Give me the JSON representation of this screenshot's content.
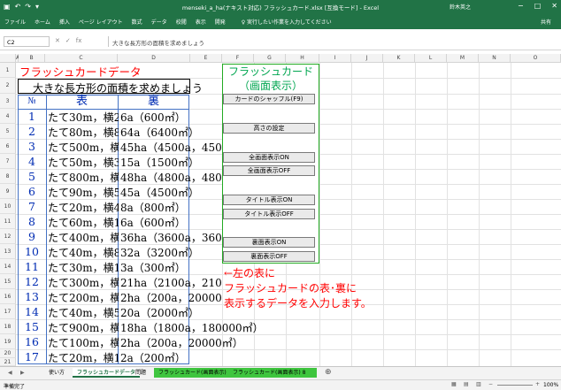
{
  "window": {
    "title": "menseki_a_ha(ナキスト対応) フラッシュカード.xlsx [互換モード] - Excel",
    "user": "鈴木英之",
    "controls": [
      "−",
      "□",
      "✕"
    ]
  },
  "ribbon_tabs": [
    "ファイル",
    "ホーム",
    "挿入",
    "ページ レイアウト",
    "数式",
    "データ",
    "校閲",
    "表示",
    "開発"
  ],
  "tell_me": "♀ 実行したい作業を入力してください",
  "share": "共有",
  "formula_bar": {
    "name_box": "C2",
    "formula": "大きな長方形の面積を求めましょう"
  },
  "columns": [
    "A",
    "B",
    "C",
    "D",
    "E",
    "F",
    "G",
    "H",
    "I",
    "J",
    "K",
    "L",
    "M",
    "N",
    "O"
  ],
  "rows": [
    "1",
    "2",
    "3",
    "4",
    "5",
    "6",
    "7",
    "8",
    "9",
    "10",
    "11",
    "12",
    "13",
    "14",
    "15",
    "16",
    "17",
    "18",
    "19",
    "20",
    "21"
  ],
  "sheet": {
    "title": "フラッシュカードデータ",
    "subtitle": "大きな長方形の面積を求めましょう",
    "col_no": "№",
    "col_omote": "表",
    "col_ura": "裏",
    "records": [
      {
        "no": "1",
        "omote": "たて30m，横2",
        "ura": "6a（600㎡）"
      },
      {
        "no": "2",
        "omote": "たて80m，横8",
        "ura": "64a（6400㎡）"
      },
      {
        "no": "3",
        "omote": "たて500m，横",
        "ura": "45ha（4500a，450000㎡）"
      },
      {
        "no": "4",
        "omote": "たて50m，横3",
        "ura": "15a（1500㎡）"
      },
      {
        "no": "5",
        "omote": "たて800m，横",
        "ura": "48ha（4800a，480000"
      },
      {
        "no": "6",
        "omote": "たて90m，横5",
        "ura": "45a（4500㎡）"
      },
      {
        "no": "7",
        "omote": "たて20m，横4",
        "ura": "8a（800㎡）"
      },
      {
        "no": "8",
        "omote": "たて60m，横1",
        "ura": "6a（600㎡）"
      },
      {
        "no": "9",
        "omote": "たて400m，横",
        "ura": "36ha（3600a，360000㎡）"
      },
      {
        "no": "10",
        "omote": "たて40m，横8",
        "ura": "32a（3200㎡）"
      },
      {
        "no": "11",
        "omote": "たて30m，横1",
        "ura": "3a（300㎡）"
      },
      {
        "no": "12",
        "omote": "たて300m，横",
        "ura": "21ha（2100a，21000"
      },
      {
        "no": "13",
        "omote": "たて200m，横",
        "ura": "2ha（200a，20000㎡"
      },
      {
        "no": "14",
        "omote": "たて40m，横5",
        "ura": "20a（2000㎡）"
      },
      {
        "no": "15",
        "omote": "たて900m，横",
        "ura": "18ha（1800a，180000㎡）"
      },
      {
        "no": "16",
        "omote": "たて100m，横",
        "ura": "2ha（200a，20000㎡）"
      },
      {
        "no": "17",
        "omote": "たて20m，横1",
        "ura": "2a（200㎡）"
      },
      {
        "no": "18",
        "omote": "たて400m，横",
        "ura": "4ha（400a，40000㎡）"
      }
    ]
  },
  "panel": {
    "title1": "フラッシュカード",
    "title2": "（画面表示）",
    "buttons": {
      "shuffle": "カードのシャッフル(F9)",
      "height": "高さの設定",
      "fullscreen_on": "全画面表示ON",
      "fullscreen_off": "全画面表示OFF",
      "title_on": "タイトル表示ON",
      "title_off": "タイトル表示OFF",
      "back_on": "裏面表示ON",
      "back_off": "裏面表示OFF"
    }
  },
  "note": {
    "line1": "←左の表に",
    "line2": "フラッシュカードの表･裏に",
    "line3": "表示するデータを入力します。"
  },
  "sheet_tabs": {
    "tab1": "使い方",
    "tab2": "フラッシュカードデータ",
    "tab3": "問題",
    "tab4": "フラッシュカード(画面表示)",
    "tab5": "フラッシュカード(画面表示) 8",
    "add": "⊕"
  },
  "status": {
    "mode": "準備完了",
    "zoom": "100%"
  }
}
